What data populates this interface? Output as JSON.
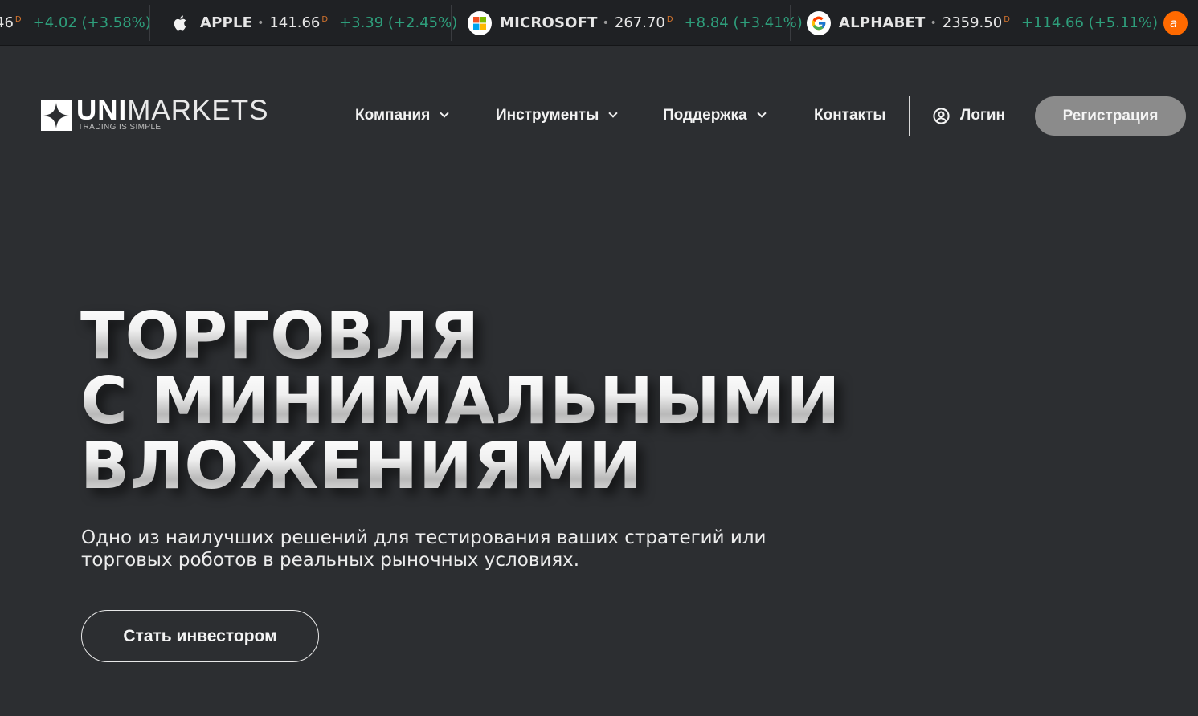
{
  "ticker": [
    {
      "name": "",
      "price": "46",
      "sup": "D",
      "change": "+4.02 (+3.58%)",
      "logo": "none"
    },
    {
      "name": "APPLE",
      "price": "141.66",
      "sup": "D",
      "change": "+3.39 (+2.45%)",
      "logo": "apple-icon"
    },
    {
      "name": "MICROSOFT",
      "price": "267.70",
      "sup": "D",
      "change": "+8.84 (+3.41%)",
      "logo": "microsoft-icon"
    },
    {
      "name": "ALPHABET",
      "price": "2359.50",
      "sup": "D",
      "change": "+114.66 (+5.11%)",
      "logo": "google-icon"
    }
  ],
  "ticker_colors": {
    "positive": "#2e9e7b",
    "suffix": "#d8762e"
  },
  "brand": {
    "name_bold": "UNI",
    "name_rest": "MARKETS",
    "tagline": "TRADING IS SIMPLE"
  },
  "nav": {
    "company": "Компания",
    "instruments": "Инструменты",
    "support": "Поддержка",
    "contacts": "Контакты",
    "login": "Логин",
    "register": "Регистрация"
  },
  "hero": {
    "title_line1": "ТОРГОВЛЯ",
    "title_line2": "С МИНИМАЛЬНЫМИ",
    "title_line3": "ВЛОЖЕНИЯМИ",
    "subtitle": "Одно из наилучших решений для тестирования ваших стратегий или торговых роботов в реальных рыночных условиях.",
    "cta": "Стать инвестором"
  }
}
